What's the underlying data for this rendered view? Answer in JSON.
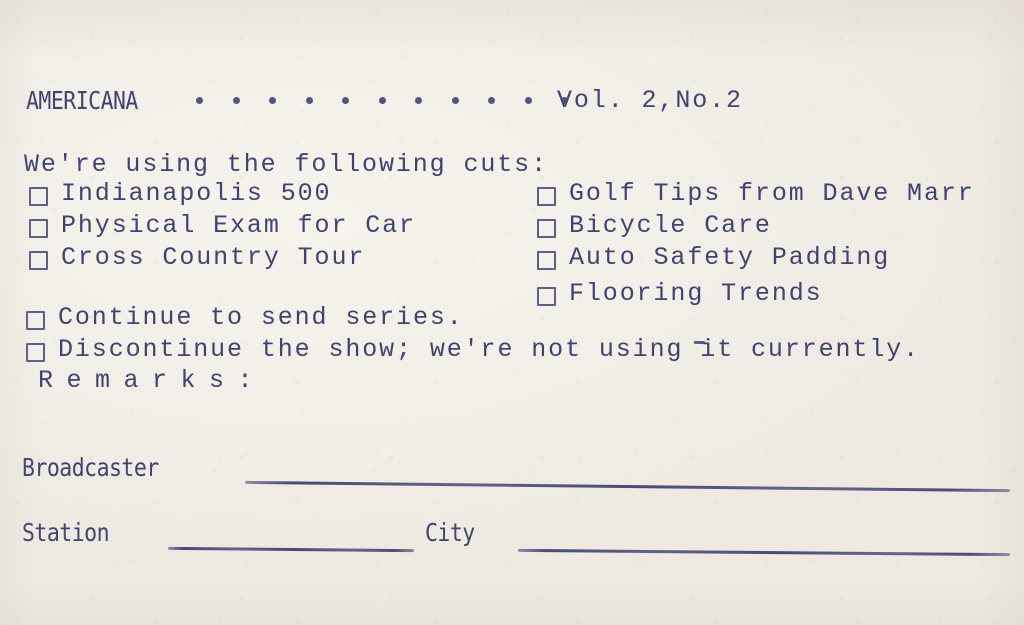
{
  "document": {
    "type": "broadcast-response-card",
    "paper_color": "#f2efe8",
    "ink_color": "#3f4370"
  },
  "header": {
    "series_title": "AMERICANA",
    "leader_dots": 11,
    "volume": "Vol. 2,No.2"
  },
  "intro": {
    "line": "We're using the following cuts:"
  },
  "cuts": {
    "left_column": [
      {
        "label": "Indianapolis 500",
        "checked": false
      },
      {
        "label": "Physical Exam for Car",
        "checked": false
      },
      {
        "label": "Cross Country Tour",
        "checked": false
      }
    ],
    "right_column": [
      {
        "label": "Golf Tips from Dave Marr",
        "checked": false
      },
      {
        "label": "Bicycle Care",
        "checked": false
      },
      {
        "label": "Auto Safety Padding",
        "checked": false
      },
      {
        "label": "Flooring Trends",
        "checked": false
      }
    ]
  },
  "decisions": [
    {
      "label": "Continue to send series.",
      "checked": false
    },
    {
      "label": "Discontinue the show; we're not using it currently.",
      "checked": false
    }
  ],
  "remarks": {
    "label": "Remarks:"
  },
  "fields": {
    "broadcaster": {
      "label": "Broadcaster",
      "value": ""
    },
    "station": {
      "label": "Station",
      "value": ""
    },
    "city": {
      "label": "City",
      "value": ""
    }
  }
}
